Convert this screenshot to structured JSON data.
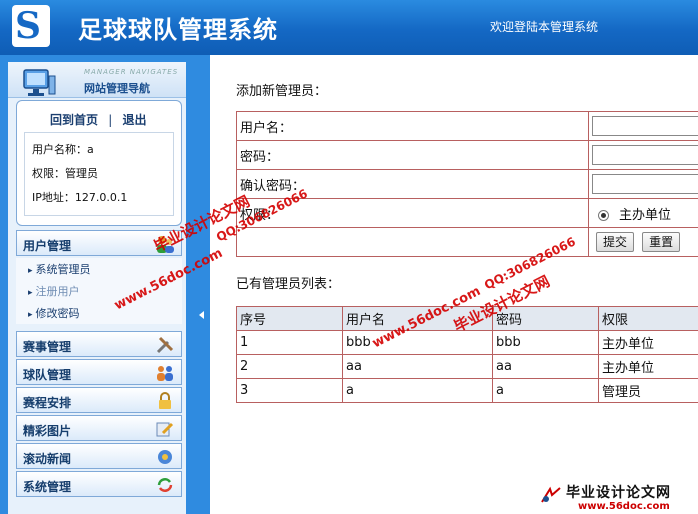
{
  "header": {
    "logo_letter": "S",
    "title": "足球球队管理系统",
    "welcome": "欢迎登陆本管理系统"
  },
  "sidebar": {
    "nav_english": "MANAGER NAVIGATES",
    "nav_title": "网站管理导航",
    "home_link": "回到首页",
    "separator": "|",
    "logout_link": "退出",
    "user_label": "用户名称：a",
    "role_label": "权限：管理员",
    "ip_label": "IP地址：127.0.0.1",
    "active_menu": {
      "title": "用户管理",
      "items": [
        "系统管理员",
        "注册用户",
        "修改密码"
      ]
    },
    "menus": [
      "赛事管理",
      "球队管理",
      "赛程安排",
      "精彩图片",
      "滚动新闻",
      "系统管理"
    ]
  },
  "main": {
    "add_title": "添加新管理员：",
    "form": {
      "username_label": "用户名：",
      "password_label": "密码：",
      "confirm_label": "确认密码：",
      "role_label": "权限：",
      "role_option": "主办单位",
      "submit_label": "提交",
      "reset_label": "重置"
    },
    "list_title": "已有管理员列表：",
    "list": {
      "headers": [
        "序号",
        "用户名",
        "密码",
        "权限"
      ],
      "rows": [
        [
          "1",
          "bbb",
          "bbb",
          "主办单位"
        ],
        [
          "2",
          "aa",
          "aa",
          "主办单位"
        ],
        [
          "3",
          "a",
          "a",
          "管理员"
        ]
      ]
    }
  },
  "watermarks": {
    "site_cn": "毕业设计论文网",
    "site_url": "www.56doc.com",
    "qq": "QQ:306826066",
    "footer_url": "www.56doc.com"
  },
  "colors": {
    "header_blue": "#1468c4",
    "sidebar_blue": "#2f8be0",
    "table_border": "#b86060",
    "watermark_red": "#d40000"
  }
}
